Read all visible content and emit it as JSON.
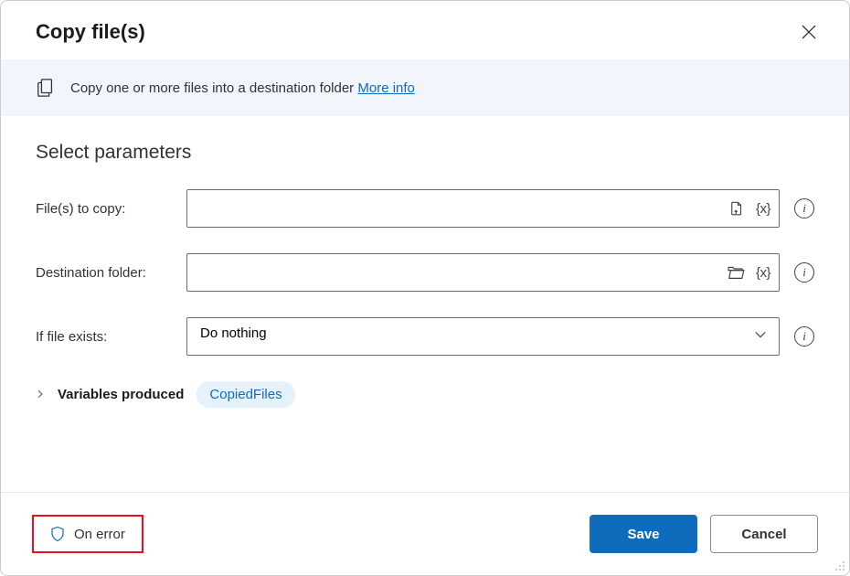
{
  "dialog": {
    "title": "Copy file(s)"
  },
  "banner": {
    "text": "Copy one or more files into a destination folder",
    "link": "More info"
  },
  "section": {
    "title": "Select parameters"
  },
  "params": {
    "files_label": "File(s) to copy:",
    "files_value": "",
    "dest_label": "Destination folder:",
    "dest_value": "",
    "exists_label": "If file exists:",
    "exists_value": "Do nothing"
  },
  "variables": {
    "label": "Variables produced",
    "chip": "CopiedFiles"
  },
  "footer": {
    "on_error": "On error",
    "save": "Save",
    "cancel": "Cancel"
  }
}
